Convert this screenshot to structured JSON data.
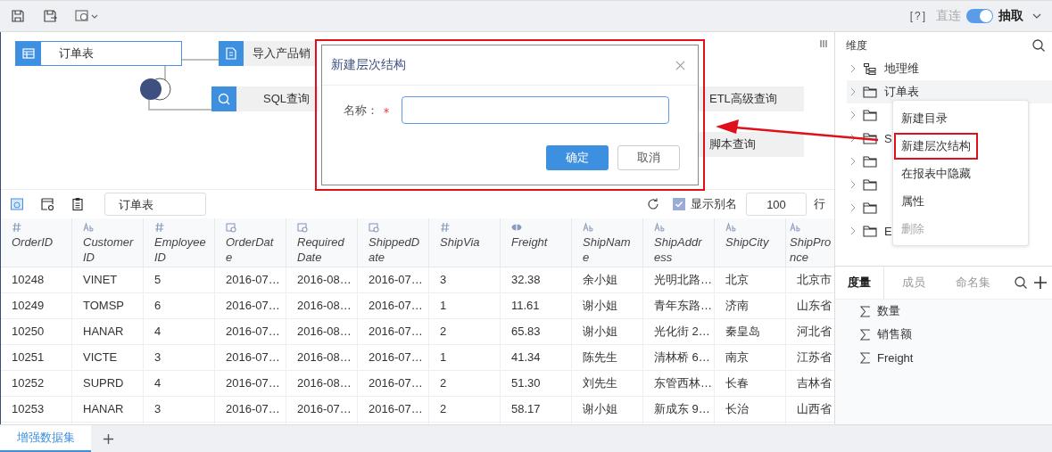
{
  "toolbar": {
    "help": "[?]",
    "mode_left": "直连",
    "toggle_on": true,
    "mode_right": "抽取"
  },
  "diagram": {
    "nodes": [
      {
        "label": "订单表",
        "kind": "table"
      },
      {
        "label": "导入产品销",
        "kind": "import"
      },
      {
        "label": "SQL查询",
        "kind": "sql"
      },
      {
        "label": "ETL高级查询",
        "kind": "etl"
      },
      {
        "label": "脚本查询",
        "kind": "script"
      }
    ]
  },
  "dialog": {
    "title": "新建层次结构",
    "field_label": "名称：",
    "required": true,
    "confirm": "确定",
    "cancel": "取消",
    "highlighted": true
  },
  "table_toolbar": {
    "table_name": "订单表",
    "show_alias": {
      "label": "显示别名",
      "checked": true
    },
    "row_limit": "100",
    "row_unit": "行"
  },
  "table": {
    "columns": [
      {
        "kind": "number",
        "lines": [
          "OrderID"
        ]
      },
      {
        "kind": "text",
        "lines": [
          "Customer",
          "ID"
        ]
      },
      {
        "kind": "number",
        "lines": [
          "Employee",
          "ID"
        ]
      },
      {
        "kind": "date",
        "lines": [
          "OrderDat",
          "e"
        ]
      },
      {
        "kind": "date",
        "lines": [
          "Required",
          "Date"
        ]
      },
      {
        "kind": "date",
        "lines": [
          "ShippedD",
          "ate"
        ]
      },
      {
        "kind": "number",
        "lines": [
          "ShipVia"
        ]
      },
      {
        "kind": "measure",
        "lines": [
          "Freight"
        ]
      },
      {
        "kind": "text",
        "lines": [
          "ShipNam",
          "e"
        ]
      },
      {
        "kind": "text",
        "lines": [
          "ShipAddr",
          "ess"
        ]
      },
      {
        "kind": "text",
        "lines": [
          "ShipCity"
        ]
      },
      {
        "kind": "text",
        "lines": [
          "ShipPro",
          "nce"
        ]
      }
    ],
    "rows": [
      [
        "10248",
        "VINET",
        "5",
        "2016-07…",
        "2016-08…",
        "2016-07…",
        "3",
        "32.38",
        "余小姐",
        "光明北路…",
        "北京",
        "北京市"
      ],
      [
        "10249",
        "TOMSP",
        "6",
        "2016-07…",
        "2016-08…",
        "2016-07…",
        "1",
        "11.61",
        "谢小姐",
        "青年东路…",
        "济南",
        "山东省"
      ],
      [
        "10250",
        "HANAR",
        "4",
        "2016-07…",
        "2016-08…",
        "2016-07…",
        "2",
        "65.83",
        "谢小姐",
        "光化街 2…",
        "秦皇岛",
        "河北省"
      ],
      [
        "10251",
        "VICTE",
        "3",
        "2016-07…",
        "2016-08…",
        "2016-07…",
        "1",
        "41.34",
        "陈先生",
        "清林桥 6…",
        "南京",
        "江苏省"
      ],
      [
        "10252",
        "SUPRD",
        "4",
        "2016-07…",
        "2016-08…",
        "2016-07…",
        "2",
        "51.30",
        "刘先生",
        "东管西林…",
        "长春",
        "吉林省"
      ],
      [
        "10253",
        "HANAR",
        "3",
        "2016-07…",
        "2016-07…",
        "2016-07…",
        "2",
        "58.17",
        "谢小姐",
        "新成东 9…",
        "长治",
        "山西省"
      ]
    ]
  },
  "bottom_tabs": [
    {
      "label": "增强数据集",
      "selected": true
    }
  ],
  "dimension_panel": {
    "title": "维度",
    "items": [
      {
        "label": "地理维",
        "kind": "hierarchy"
      },
      {
        "label": "订单表",
        "kind": "folder"
      },
      {
        "kind": "folder"
      },
      {
        "label": "S",
        "kind": "folder"
      },
      {
        "kind": "folder"
      },
      {
        "kind": "folder"
      },
      {
        "kind": "folder"
      },
      {
        "label": "E",
        "kind": "folder"
      }
    ]
  },
  "context_menu": [
    {
      "label": "新建目录",
      "disabled": false,
      "highlighted": false
    },
    {
      "label": "新建层次结构",
      "disabled": false,
      "highlighted": true
    },
    {
      "label": "在报表中隐藏",
      "disabled": false,
      "highlighted": false
    },
    {
      "label": "属性",
      "disabled": false,
      "highlighted": false
    },
    {
      "label": "删除",
      "disabled": true,
      "highlighted": false
    }
  ],
  "measure_panel": {
    "tabs": [
      {
        "label": "度量",
        "selected": true
      },
      {
        "label": "成员",
        "selected": false
      },
      {
        "label": "命名集",
        "selected": false
      }
    ],
    "items": [
      "数量",
      "销售额",
      "Freight"
    ]
  }
}
